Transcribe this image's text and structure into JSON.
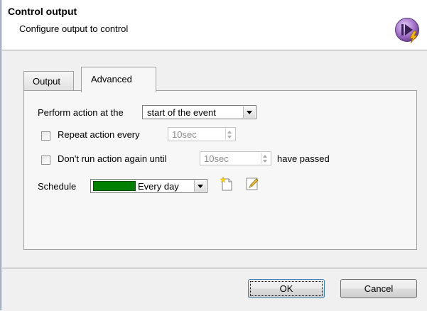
{
  "header": {
    "title": "Control output",
    "subtitle": "Configure output to control",
    "icon": "control-output-icon"
  },
  "tabs": [
    {
      "label": "Output",
      "selected": false
    },
    {
      "label": "Advanced",
      "selected": true
    }
  ],
  "advanced": {
    "perform_label": "Perform action at the",
    "perform_value": "start of the event",
    "repeat_label": "Repeat action every",
    "repeat_checked": false,
    "repeat_value": "10sec",
    "dont_run_label": "Don't run action again until",
    "dont_run_checked": false,
    "dont_run_value": "10sec",
    "have_passed_label": "have passed",
    "schedule_label": "Schedule",
    "schedule_value": "Every day",
    "schedule_color": "#008000",
    "new_schedule_icon": "new-document-icon",
    "edit_schedule_icon": "edit-pencil-icon"
  },
  "footer": {
    "ok_label": "OK",
    "cancel_label": "Cancel"
  }
}
